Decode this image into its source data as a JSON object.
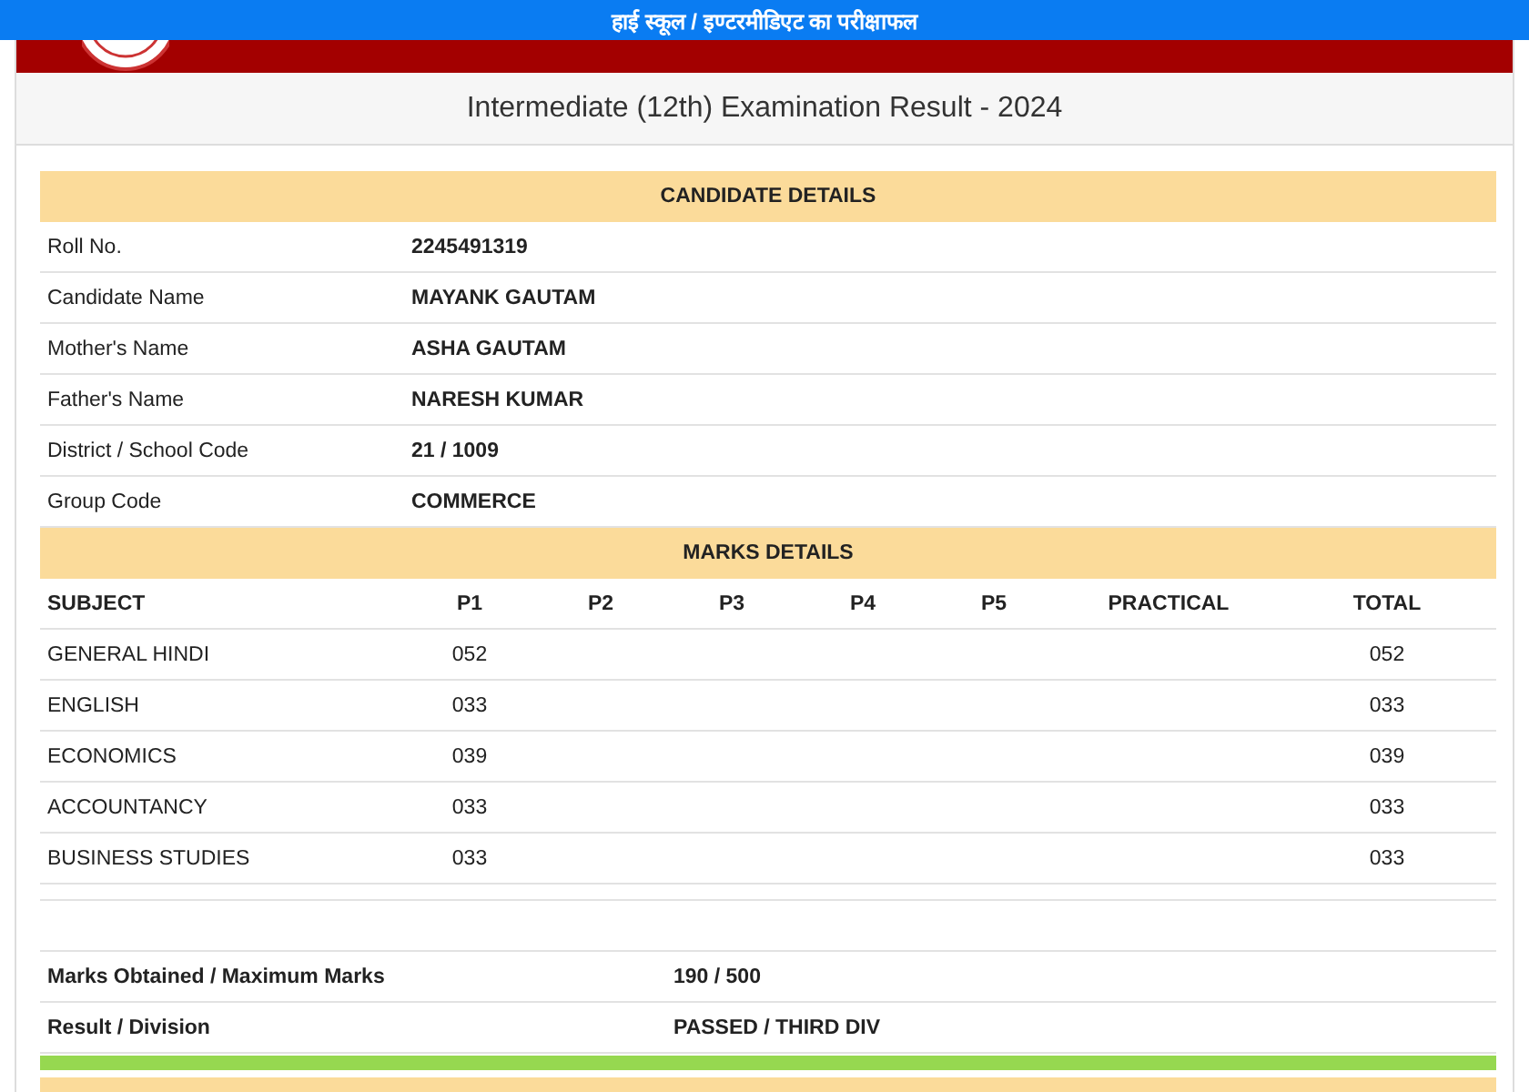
{
  "top_bar": {
    "title": "हाई स्कूल / इण्टरमीडिएट का परीक्षाफल"
  },
  "page_title": "Intermediate (12th) Examination Result - 2024",
  "candidate_details": {
    "heading": "CANDIDATE DETAILS",
    "rows": [
      {
        "label": "Roll No.",
        "value": "2245491319"
      },
      {
        "label": "Candidate Name",
        "value": "MAYANK GAUTAM"
      },
      {
        "label": "Mother's Name",
        "value": "ASHA GAUTAM"
      },
      {
        "label": "Father's Name",
        "value": "NARESH KUMAR"
      },
      {
        "label": "District / School Code",
        "value": "21 / 1009"
      },
      {
        "label": "Group Code",
        "value": "COMMERCE"
      }
    ]
  },
  "marks_details": {
    "heading": "MARKS DETAILS",
    "columns": [
      "SUBJECT",
      "P1",
      "P2",
      "P3",
      "P4",
      "P5",
      "PRACTICAL",
      "TOTAL"
    ],
    "rows": [
      {
        "cells": [
          "GENERAL HINDI",
          "052",
          null,
          null,
          null,
          null,
          null,
          "052"
        ]
      },
      {
        "cells": [
          "ENGLISH",
          "033",
          null,
          null,
          null,
          null,
          null,
          "033"
        ]
      },
      {
        "cells": [
          "ECONOMICS",
          "039",
          null,
          null,
          null,
          null,
          null,
          "039"
        ]
      },
      {
        "cells": [
          "ACCOUNTANCY",
          "033",
          null,
          null,
          null,
          null,
          null,
          "033"
        ]
      },
      {
        "cells": [
          "BUSINESS STUDIES",
          "033",
          null,
          null,
          null,
          null,
          null,
          "033"
        ]
      }
    ]
  },
  "summary": [
    {
      "label": "Marks Obtained / Maximum Marks",
      "value": "190 / 500"
    },
    {
      "label": "Result / Division",
      "value": "PASSED / THIRD DIV"
    }
  ]
}
